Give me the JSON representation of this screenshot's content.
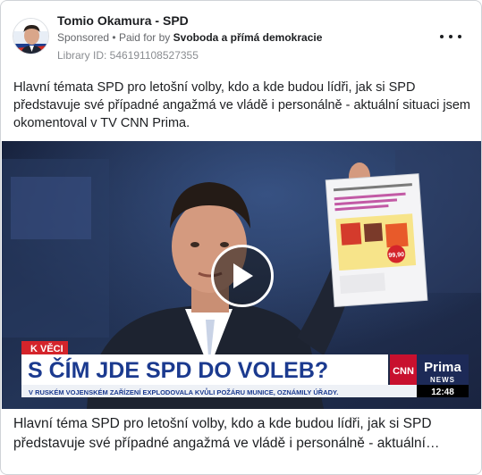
{
  "header": {
    "page_name": "Tomio Okamura - SPD",
    "sponsored_label": "Sponsored",
    "separator": "•",
    "paid_for_prefix": "Paid for by",
    "payer": "Svoboda a přímá demokracie",
    "library_id": "Library ID: 546191108527355",
    "more_icon": "more-horizontal-icon"
  },
  "post": {
    "text": "Hlavní témata SPD pro letošní volby, kdo a kde budou lídři, jak si SPD představuje své případné angažmá ve vládě i personálně - aktuální situaci jsem okomentoval v TV CNN Prima."
  },
  "video": {
    "kicker": "K VĚCI",
    "headline": "S ČÍM JDE SPD DO VOLEB?",
    "ticker": "V RUSKÉM VOJENSKÉM ZAŘÍZENÍ EXPLODOVALA KVŮLI POŽÁRU MUNICE, OZNÁMILY ÚŘADY.",
    "channel_cnn": "CNN",
    "channel_prima": "Prima",
    "channel_news": "NEWS",
    "clock": "12:48",
    "play_icon": "play-icon",
    "leaflet_price": "99,90",
    "colors": {
      "kicker_red": "#d4242b",
      "headline_blue": "#1b3a8f",
      "ticker_bg": "#ffffff",
      "clock_bg": "#000000"
    }
  },
  "caption": {
    "text": "Hlavní téma SPD pro letošní volby, kdo a kde budou lídři, jak si SPD představuje své případné angažmá ve vládě i personálně - aktuální…"
  }
}
